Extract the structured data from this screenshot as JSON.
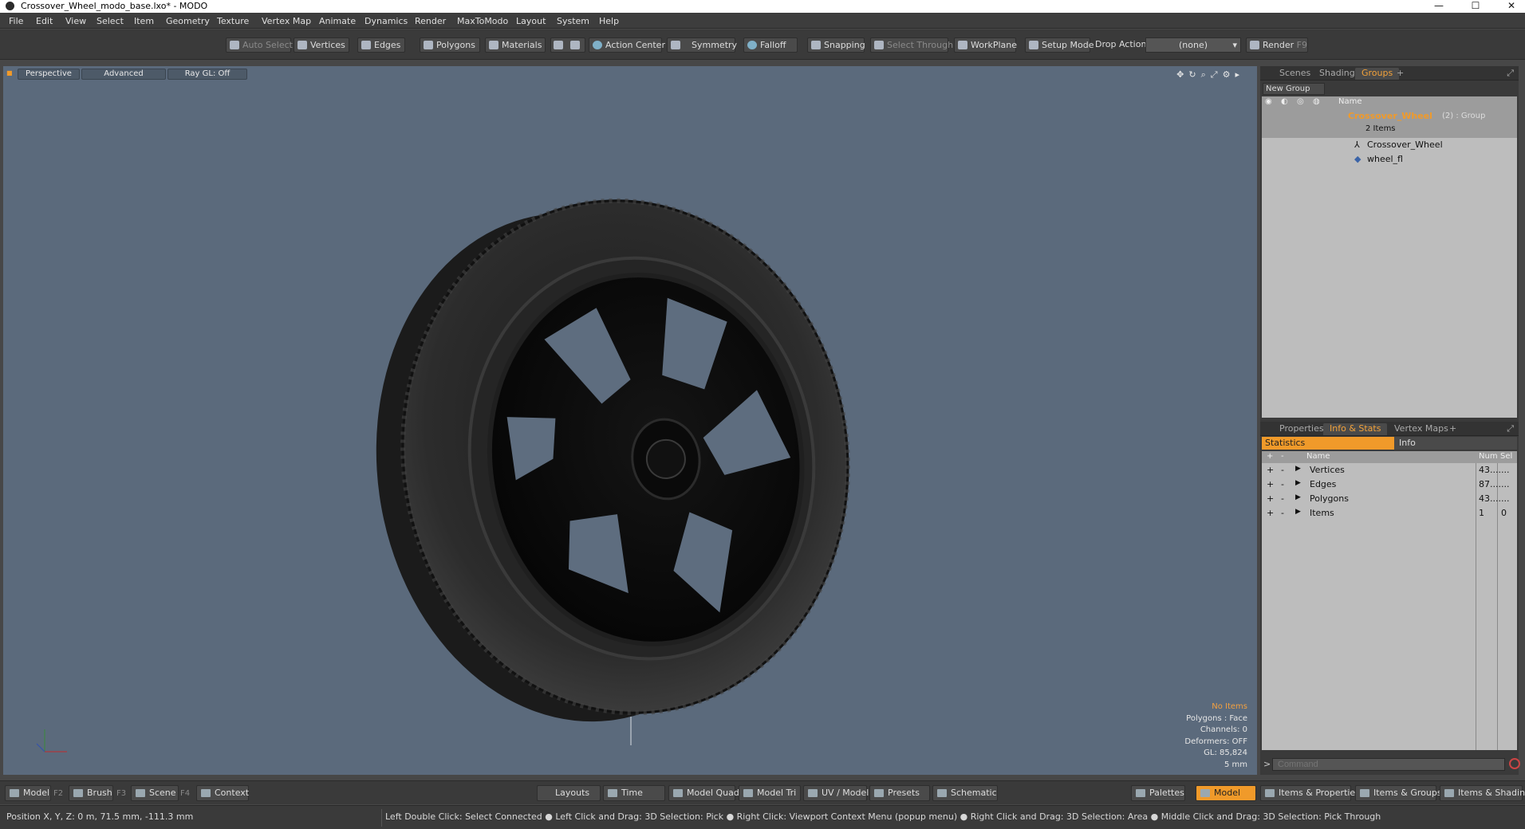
{
  "window": {
    "title": "Crossover_Wheel_modo_base.lxo* - MODO",
    "minimize": "—",
    "maximize": "☐",
    "close": "✕"
  },
  "menu": [
    "File",
    "Edit",
    "View",
    "Select",
    "Item",
    "Geometry",
    "Texture",
    "Vertex Map",
    "Animate",
    "Dynamics",
    "Render",
    "MaxToModo",
    "Layout",
    "System",
    "Help"
  ],
  "toolbar": {
    "auto_select": "Auto Select",
    "vertices": "Vertices",
    "edges": "Edges",
    "polygons": "Polygons",
    "materials": "Materials",
    "action_center": "Action Center",
    "symmetry": "Symmetry",
    "falloff": "Falloff",
    "snapping": "Snapping",
    "select_through": "Select Through",
    "workplane": "WorkPlane",
    "setup_mode": "Setup Mode",
    "drop_action": "Drop Action",
    "drop_value": "(none)",
    "render": "Render",
    "render_key": "F9"
  },
  "viewport": {
    "view": "Perspective",
    "shading": "Advanced",
    "raygl": "Ray GL: Off",
    "info": {
      "no_items": "No Items",
      "polygons": "Polygons : Face",
      "channels": "Channels: 0",
      "deformers": "Deformers: OFF",
      "gl": "GL: 85,824",
      "unit": "5 mm"
    }
  },
  "groups_panel": {
    "tabs": [
      "Scenes",
      "Shading",
      "Groups"
    ],
    "active_tab": "Groups",
    "plus": "+",
    "new_group": "New Group",
    "name_header": "Name",
    "group_name": "Crossover_Wheel",
    "group_suffix": "(2) : Group",
    "group_count": "2 Items",
    "children": [
      "Crossover_Wheel",
      "wheel_fl"
    ]
  },
  "stats_panel": {
    "tabs": [
      "Properties",
      "Info & Stats",
      "Vertex Maps"
    ],
    "active_tab": "Info & Stats",
    "plus": "+",
    "sub_tabs": [
      "Statistics",
      "Info"
    ],
    "headers": {
      "plus": "+",
      "minus": "-",
      "name": "Name",
      "num": "Num",
      "sel": "Sel"
    },
    "rows": [
      {
        "name": "Vertices",
        "num": "43....",
        "sel": "..."
      },
      {
        "name": "Edges",
        "num": "87....",
        "sel": "..."
      },
      {
        "name": "Polygons",
        "num": "43....",
        "sel": "..."
      },
      {
        "name": "Items",
        "num": "1",
        "sel": "0"
      }
    ]
  },
  "command": {
    "prompt": ">",
    "placeholder": "Command"
  },
  "bottombar": {
    "model": "Model",
    "f2": "F2",
    "brush": "Brush",
    "f3": "F3",
    "scene": "Scene",
    "f4": "F4",
    "context": "Context",
    "layouts": "Layouts",
    "time": "Time",
    "model_quad": "Model Quad",
    "model_tri": "Model Tri",
    "uv_model": "UV / Model",
    "presets": "Presets",
    "schematic": "Schematic",
    "palettes": "Palettes",
    "model_active": "Model",
    "items_properties": "Items & Properties",
    "items_groups": "Items & Groups",
    "items_shading": "Items & Shading"
  },
  "status": {
    "position": "Position X, Y, Z:   0 m, 71.5 mm, -111.3 mm",
    "hints": "Left Double Click: Select Connected ● Left Click and Drag: 3D Selection: Pick ● Right Click: Viewport Context Menu (popup menu) ● Right Click and Drag: 3D Selection: Area ● Middle Click and Drag: 3D Selection: Pick Through"
  },
  "colors": {
    "accent": "#f09a2a",
    "viewport_bg": "#5b6a7c",
    "panel_bg": "#3a3a3a",
    "list_bg": "#bdbdbd"
  }
}
